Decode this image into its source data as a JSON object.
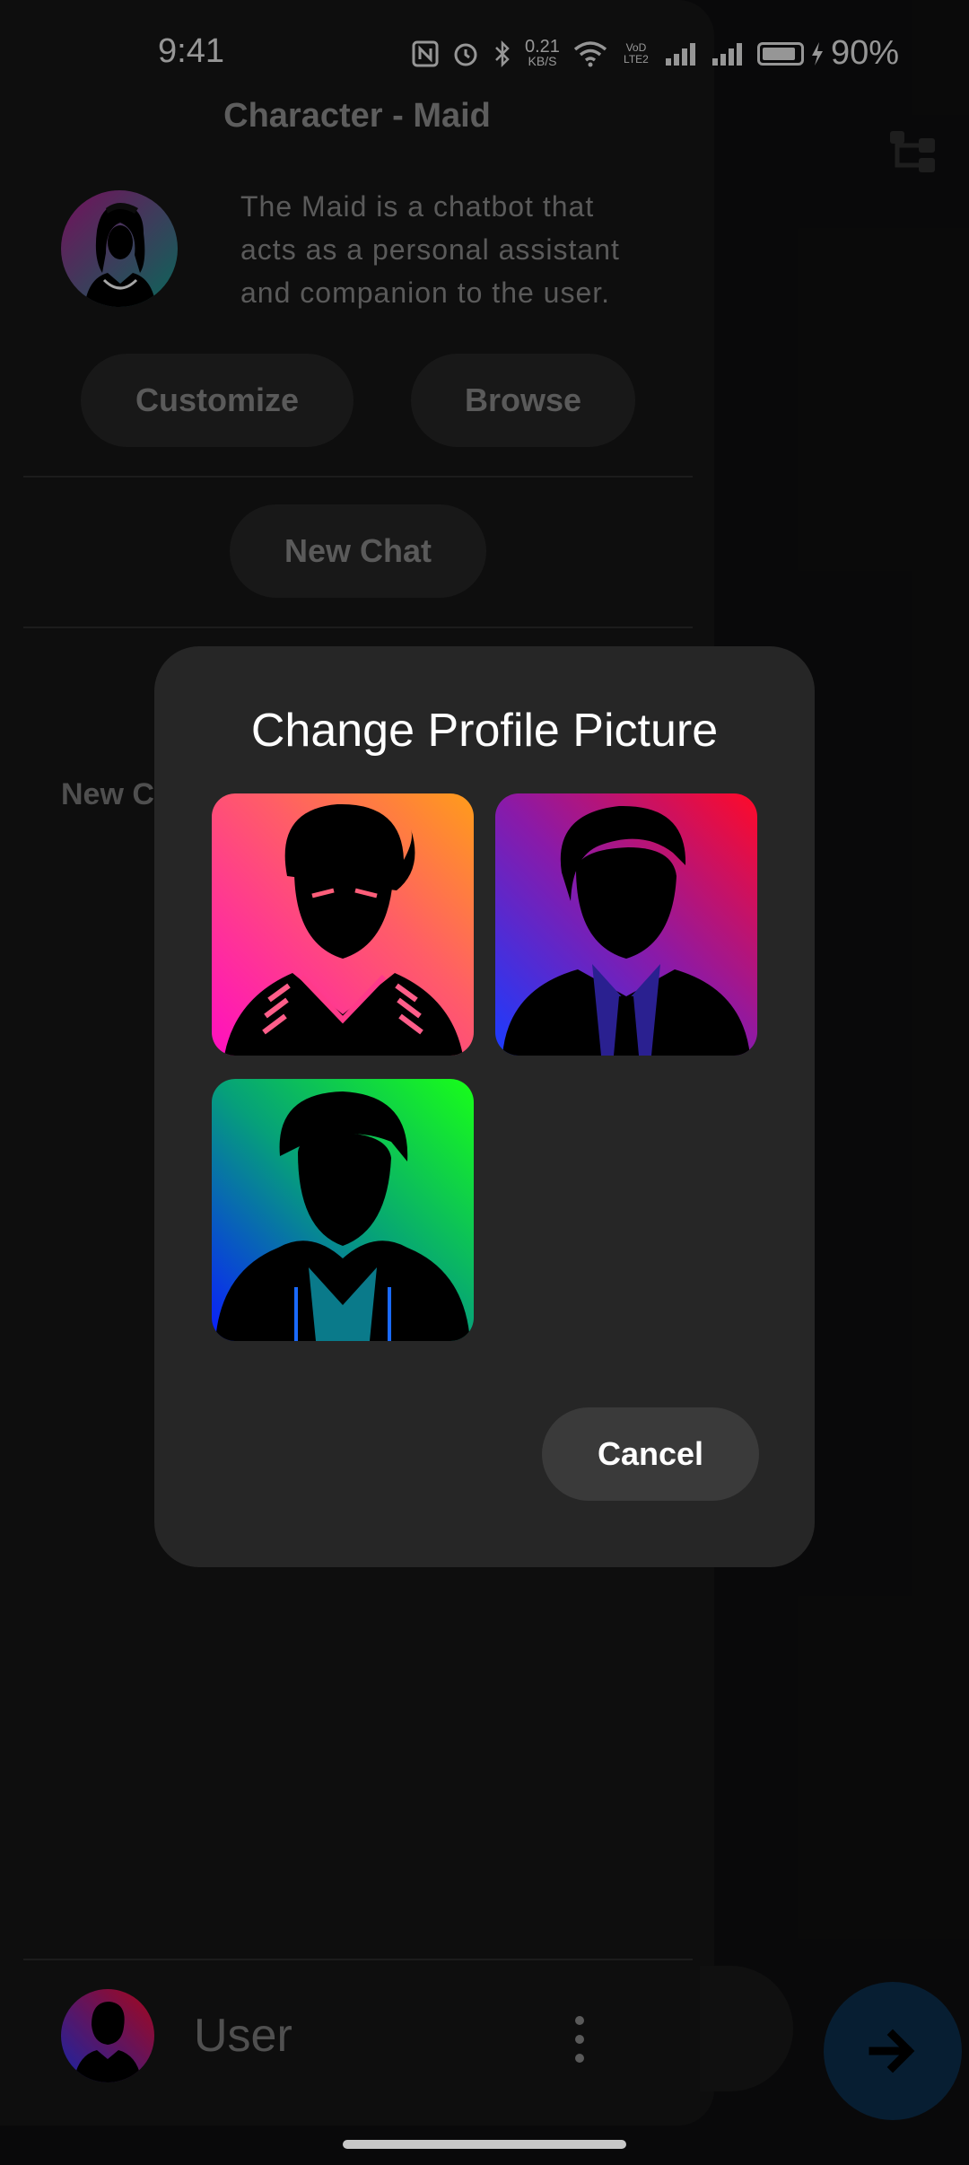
{
  "status_bar": {
    "time": "9:41",
    "net_speed_value": "0.21",
    "net_speed_unit": "KB/S",
    "volte": "VoD LTE2",
    "battery_percent": "90%",
    "battery_level": 0.9
  },
  "header": {
    "title": "Character - Maid"
  },
  "character": {
    "description": "The Maid is a chatbot that acts as a personal assistant and companion to the user.",
    "customize_label": "Customize",
    "browse_label": "Browse"
  },
  "new_chat_label": "New Chat",
  "chat_list_partial": "New C",
  "user": {
    "name": "User"
  },
  "dialog": {
    "title": "Change Profile Picture",
    "options": [
      {
        "name": "bearded-man-avatar",
        "gradient": [
          "#ff4a8a",
          "#ff9a1a"
        ]
      },
      {
        "name": "suited-man-avatar",
        "gradient": [
          "#2438ff",
          "#ff0a2a"
        ]
      },
      {
        "name": "hoodie-man-avatar",
        "gradient": [
          "#0a2cff",
          "#1aff2a"
        ]
      }
    ],
    "cancel_label": "Cancel"
  },
  "colors": {
    "background": "#0f0f10",
    "drawer": "#161616",
    "dialog": "#262626",
    "pill": "#262626",
    "send_button": "#0c2f4d"
  }
}
